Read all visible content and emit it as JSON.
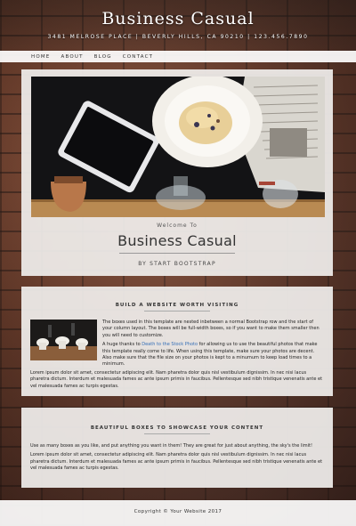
{
  "header": {
    "title": "Business Casual",
    "address": "3481 MELROSE PLACE | BEVERLY HILLS, CA 90210 | 123.456.7890"
  },
  "nav": {
    "items": [
      "HOME",
      "ABOUT",
      "BLOG",
      "CONTACT"
    ]
  },
  "hero": {
    "welcome": "Welcome To",
    "title": "Business Casual",
    "subtitle": "BY START BOOTSTRAP"
  },
  "section1": {
    "heading": "BUILD A WEBSITE WORTH VISITING",
    "p1": "The boxes used in this template are nested inbetween a normal Bootstrap row and the start of your column layout. The boxes will be full-width boxes, so if you want to make them smaller then you will need to customize.",
    "p2_prefix": "A huge thanks to ",
    "p2_link": "Death to the Stock Photo",
    "p2_suffix": " for allowing us to use the beautiful photos that make this template really come to life. When using this template, make sure your photos are decent. Also make sure that the file size on your photos is kept to a minumum to keep load times to a minimum.",
    "p3": "Lorem ipsum dolor sit amet, consectetur adipiscing elit. Nam pharetra dolor quis nisl vestibulum dignissim. In nec nisi lacus pharetra dictum. Interdum et malesuada fames ac ante ipsum primis in faucibus. Pellentesque sed nibh tristique venenatis ante et vel malesuada fames ac turpis egestas."
  },
  "section2": {
    "heading": "BEAUTIFUL BOXES TO SHOWCASE YOUR CONTENT",
    "p1": "Use as many boxes as you like, and put anything you want in them! They are great for just about anything, the sky's the limit!",
    "p2": "Lorem ipsum dolor sit amet, consectetur adipiscing elit. Nam pharetra dolor quis nisl vestibulum dignissim. In nec nisi lacus pharetra dictum. Interdum et malesuada fames ac ante ipsum primis in faucibus. Pellentesque sed nibh tristique venenatis ante et vel malesuada fames ac turpis egestas."
  },
  "footer": {
    "copyright": "Copyright © Your Website 2017"
  }
}
